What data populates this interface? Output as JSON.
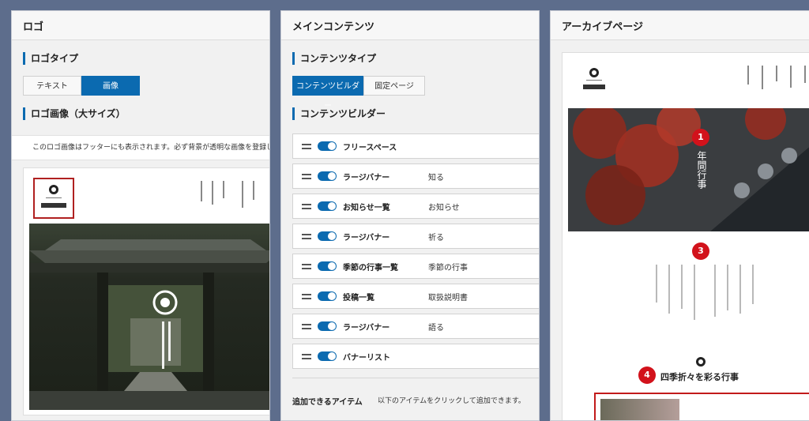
{
  "logo_panel": {
    "title": "ロゴ",
    "logo_type": {
      "heading": "ロゴタイプ",
      "options": [
        "テキスト",
        "画像"
      ],
      "selected": "画像"
    },
    "logo_image": {
      "heading": "ロゴ画像（大サイズ）",
      "note": "このロゴ画像はフッターにも表示されます。必ず背景が透明な画像を登録してくだ"
    }
  },
  "content_panel": {
    "title": "メインコンテンツ",
    "content_type": {
      "heading": "コンテンツタイプ",
      "options": [
        "コンテンツビルダー",
        "固定ページ"
      ],
      "selected": "コンテンツビルダー"
    },
    "builder": {
      "heading": "コンテンツビルダー",
      "rows": [
        {
          "label": "フリースペース",
          "sub": ""
        },
        {
          "label": "ラージバナー",
          "sub": "知る"
        },
        {
          "label": "お知らせ一覧",
          "sub": "お知らせ"
        },
        {
          "label": "ラージバナー",
          "sub": "祈る"
        },
        {
          "label": "季節の行事一覧",
          "sub": "季節の行事"
        },
        {
          "label": "投稿一覧",
          "sub": "取扱説明書"
        },
        {
          "label": "ラージバナー",
          "sub": "語る"
        },
        {
          "label": "バナーリスト",
          "sub": ""
        }
      ]
    },
    "addable": {
      "heading": "追加できるアイテム",
      "hint": "以下のアイテムをクリックして追加できます。"
    }
  },
  "archive_panel": {
    "title": "アーカイブページ",
    "hero_text": "年間行事",
    "season_heading": "四季折々を彩る行事",
    "badges": [
      "1",
      "3",
      "4"
    ]
  },
  "colors": {
    "accent": "#0b6ab0",
    "badge": "#d2121b"
  }
}
